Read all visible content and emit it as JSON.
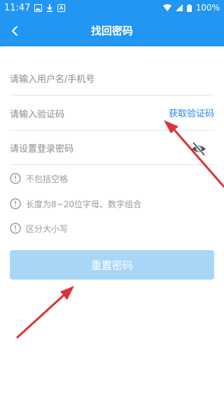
{
  "status_bar": {
    "time": "11:47",
    "battery": "100%",
    "left_icons": [
      "image-icon",
      "download-icon",
      "app-icon"
    ],
    "right_icons": [
      "wifi-icon",
      "signal-icon",
      "battery-icon"
    ]
  },
  "header": {
    "title": "找回密码",
    "back_icon": "chevron-left-icon"
  },
  "form": {
    "username_placeholder": "请输入用户名/手机号",
    "code_placeholder": "请输入验证码",
    "get_code_label": "获取验证码",
    "password_placeholder": "请设置登录密码",
    "eye_icon": "eye-off-icon"
  },
  "rules": [
    {
      "text": "不包括空格",
      "icon": "info-icon"
    },
    {
      "text": "长度为8~20位字母、数字组合",
      "icon": "info-icon"
    },
    {
      "text": "区分大小写",
      "icon": "info-icon"
    }
  ],
  "submit_label": "重置密码",
  "colors": {
    "brand": "#2196f3",
    "link": "#1e88e5",
    "button_disabled": "#a9d6f7",
    "annotation_arrow": "#d8343a"
  }
}
